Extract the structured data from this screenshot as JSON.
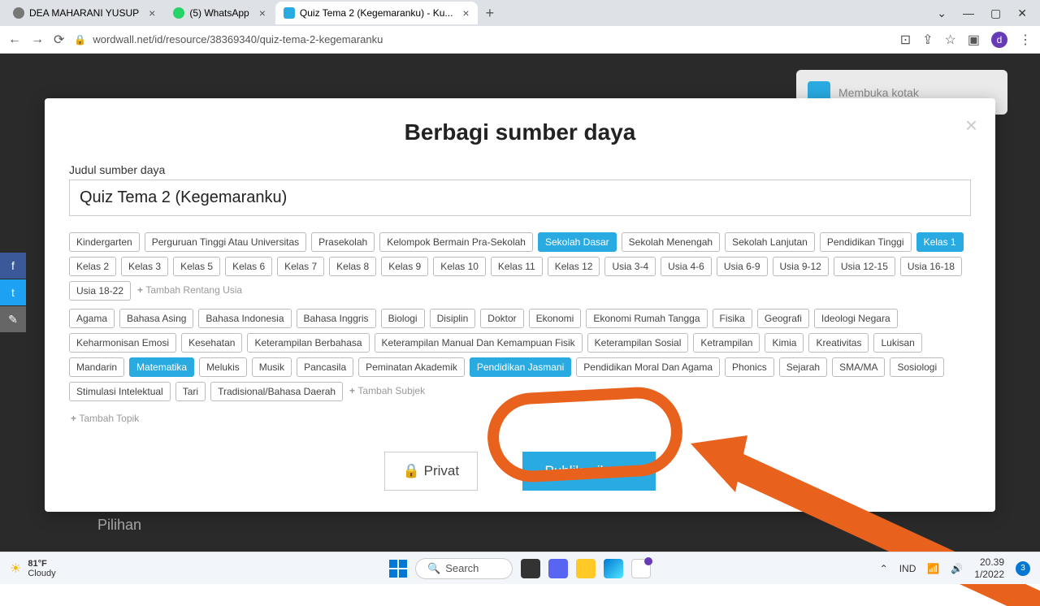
{
  "browser": {
    "tabs": [
      {
        "title": "DEA MAHARANI YUSUP"
      },
      {
        "title": "(5) WhatsApp"
      },
      {
        "title": "Quiz Tema 2 (Kegemaranku) - Ku..."
      }
    ],
    "url": "wordwall.net/id/resource/38369340/quiz-tema-2-kegemaranku",
    "profile_letter": "d"
  },
  "bg": {
    "card_label": "Membuka kotak",
    "pilihan": "Pilihan"
  },
  "modal": {
    "title": "Berbagi sumber daya",
    "field_label": "Judul sumber daya",
    "input_value": "Quiz Tema 2 (Kegemaranku)",
    "row1": {
      "tags": [
        "Kindergarten",
        "Perguruan Tinggi Atau Universitas",
        "Prasekolah",
        "Kelompok Bermain Pra-Sekolah",
        "Sekolah Dasar",
        "Sekolah Menengah",
        "Sekolah Lanjutan",
        "Pendidikan Tinggi",
        "Kelas 1",
        "Kelas 2",
        "Kelas 3",
        "Kelas 5",
        "Kelas 6",
        "Kelas 7",
        "Kelas 8",
        "Kelas 9",
        "Kelas 10",
        "Kelas 11",
        "Kelas 12",
        "Usia 3-4",
        "Usia 4-6",
        "Usia 6-9",
        "Usia 9-12",
        "Usia 12-15",
        "Usia 16-18",
        "Usia 18-22"
      ],
      "add": "Tambah Rentang Usia"
    },
    "row2": {
      "tags": [
        "Agama",
        "Bahasa Asing",
        "Bahasa Indonesia",
        "Bahasa Inggris",
        "Biologi",
        "Disiplin",
        "Doktor",
        "Ekonomi",
        "Ekonomi Rumah Tangga",
        "Fisika",
        "Geografi",
        "Ideologi Negara",
        "Keharmonisan Emosi",
        "Kesehatan",
        "Keterampilan Berbahasa",
        "Keterampilan Manual Dan Kemampuan Fisik",
        "Keterampilan Sosial",
        "Ketrampilan",
        "Kimia",
        "Kreativitas",
        "Lukisan",
        "Mandarin",
        "Matematika",
        "Melukis",
        "Musik",
        "Pancasila",
        "Peminatan Akademik",
        "Pendidikan Jasmani",
        "Pendidikan Moral Dan Agama",
        "Phonics",
        "Sejarah",
        "SMA/MA",
        "Sosiologi",
        "Stimulasi Intelektual",
        "Tari",
        "Tradisional/Bahasa Daerah"
      ],
      "add": "Tambah Subjek"
    },
    "add_topic": "Tambah Topik",
    "private_btn": "Privat",
    "publish_btn": "Publikasikan  ▸"
  },
  "selected_tags": [
    "Sekolah Dasar",
    "Kelas 1",
    "Matematika",
    "Pendidikan Jasmani"
  ],
  "taskbar": {
    "temp": "81°F",
    "cond": "Cloudy",
    "search": "Search",
    "lang": "IND",
    "time": "20.39",
    "date": "1/2022",
    "notif": "3"
  }
}
